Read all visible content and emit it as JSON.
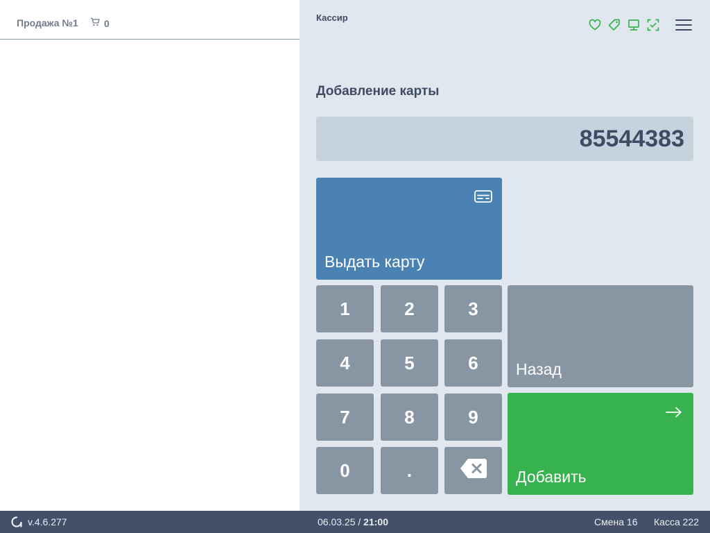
{
  "sale": {
    "title": "Продажа №1",
    "cart_count": "0"
  },
  "header": {
    "role": "Кассир",
    "status_icons": [
      "heart-icon",
      "tag-icon",
      "monitor-icon",
      "scan-check-icon"
    ],
    "accent_color": "#36b34f"
  },
  "form": {
    "title": "Добавление карты",
    "card_number": "85544383"
  },
  "buttons": {
    "issue_card": "Выдать карту",
    "back": "Назад",
    "add": "Добавить"
  },
  "keypad": [
    "1",
    "2",
    "3",
    "4",
    "5",
    "6",
    "7",
    "8",
    "9",
    "0",
    "."
  ],
  "footer": {
    "version": "v.4.6.277",
    "date": "06.03.25",
    "separator": "/",
    "time": "21:00",
    "shift": "Смена 16",
    "register": "Касса 222"
  },
  "colors": {
    "issue_button": "#4b82b4",
    "neutral_button": "#8896a4",
    "add_button": "#36b34f",
    "footer": "#445068",
    "panel": "#e1e7ee"
  }
}
